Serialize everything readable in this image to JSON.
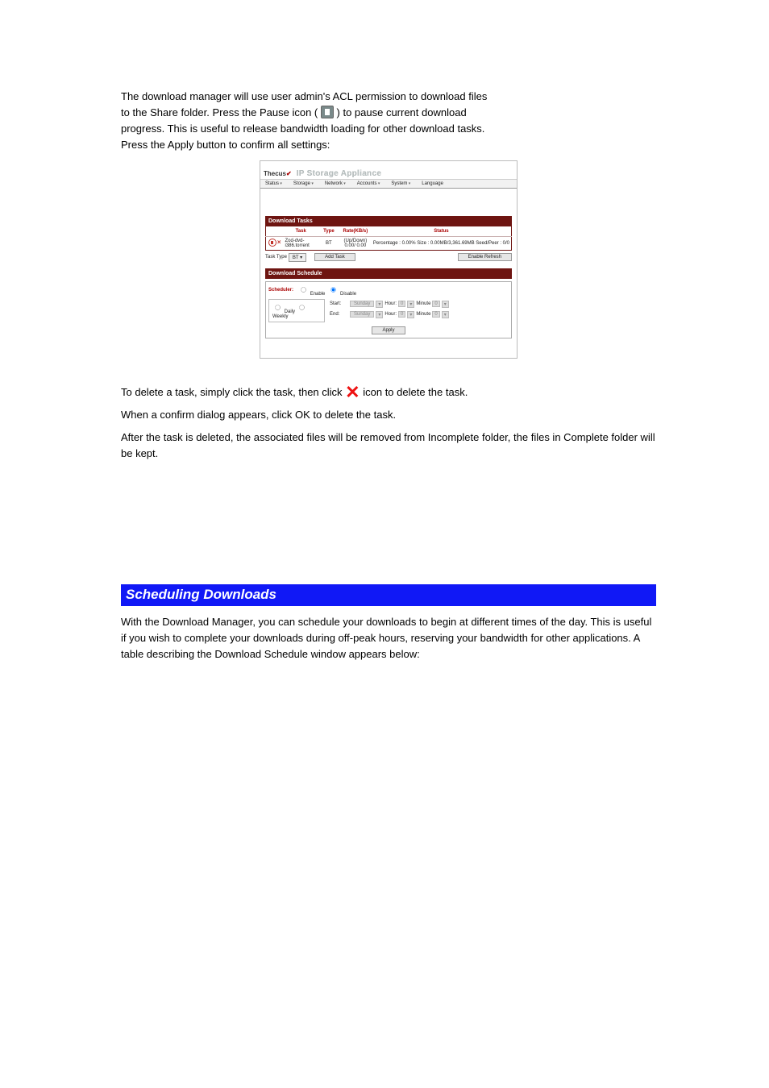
{
  "intro_para": {
    "line1": "The download manager will use user admin's ACL permission to download files",
    "line2_a": "to the Share folder.  Press the Pause icon (",
    "line2_b": ") to pause current download",
    "line3": "progress.  This is useful to release bandwidth loading for other download tasks.",
    "line4": "Press the Apply button to confirm all settings:"
  },
  "embed": {
    "logo": "Thecus",
    "title": "IP Storage Appliance",
    "menu": [
      "Status",
      "Storage",
      "Network",
      "Accounts",
      "System",
      "Language"
    ],
    "download_tasks_header": "Download Tasks",
    "table": {
      "cols": [
        "",
        "Task",
        "Type",
        "Rate(KB/s)",
        "Status"
      ],
      "row": {
        "task": "Zod-dvd-i386.torrent",
        "type": "BT",
        "rate": "(Up/Down) 0.00/ 0.00",
        "status": "Percentage : 0.00% Size : 0.00MB/3,361.69MB Seed/Peer : 0/0"
      }
    },
    "task_type_label": "Task Type",
    "task_type_value": "BT",
    "add_task": "Add Task",
    "enable_refresh": "Enable Refresh",
    "download_schedule_header": "Download Schedule",
    "scheduler_label": "Scheduler:",
    "enable": "Enable",
    "disable": "Disable",
    "daily": "Daily",
    "weekly": "Weekly",
    "start": "Start:",
    "end": "End:",
    "day": "Sunday",
    "hour_label": "Hour:",
    "hour_val": "0",
    "minute_label": "Minute",
    "minute_val": "0",
    "apply": "Apply"
  },
  "deleting_tasks": {
    "p1_a": "To delete a task, simply click the task, then click ",
    "p1_b": " icon to delete the task.",
    "p2": "When a confirm dialog appears, click OK to delete the task.",
    "p3": "After the task is deleted, the associated files will be removed from Incomplete folder, the files in Complete folder will be kept."
  },
  "scheduling_section": {
    "heading": "Scheduling Downloads",
    "p1": "With the Download Manager, you can schedule your downloads to begin at different times of the day. This is useful if you wish to complete your downloads during off-peak hours, reserving your bandwidth for other applications. A table describing the Download Schedule window appears below:"
  }
}
